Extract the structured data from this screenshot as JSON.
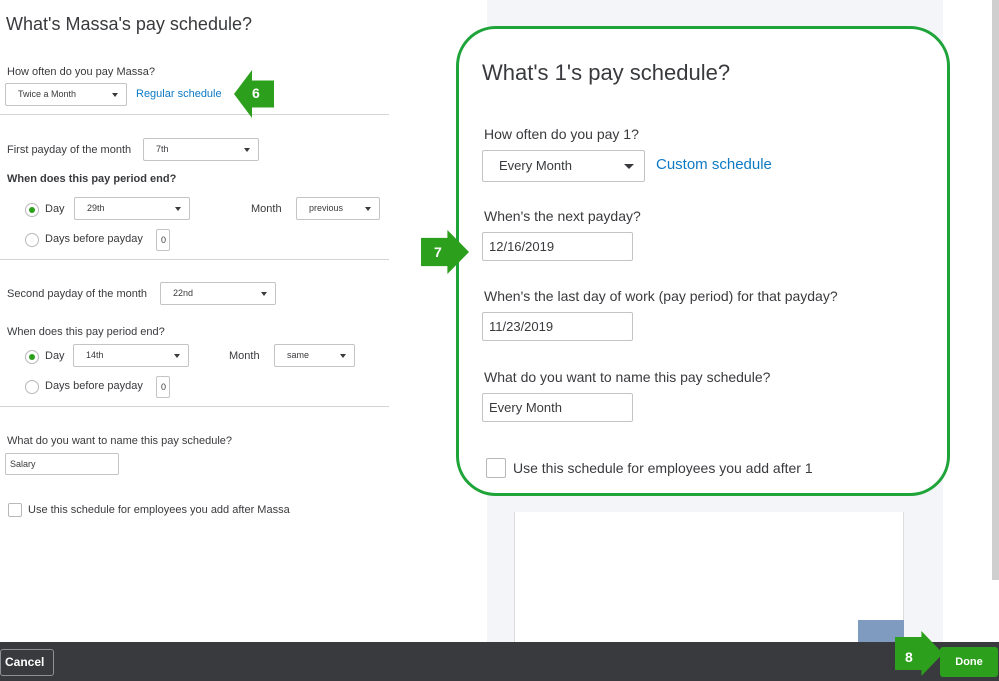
{
  "left": {
    "title": "What's Massa's pay schedule?",
    "frequency_label": "How often do you pay Massa?",
    "frequency_value": "Twice a Month",
    "frequency_link": "Regular schedule",
    "first_payday_label": "First payday of the month",
    "first_payday_value": "7th",
    "first_period_end_label": "When does this pay period end?",
    "first_day_option": "Day",
    "first_day_value": "29th",
    "first_month_label": "Month",
    "first_month_value": "previous",
    "first_days_before_label": "Days before payday",
    "first_days_before_value": "0",
    "second_payday_label": "Second payday of the month",
    "second_payday_value": "22nd",
    "second_period_end_label": "When does this pay period end?",
    "second_day_option": "Day",
    "second_day_value": "14th",
    "second_month_label": "Month",
    "second_month_value": "same",
    "second_days_before_label": "Days before payday",
    "second_days_before_value": "0",
    "name_label": "What do you want to name this pay schedule?",
    "name_value": "Salary",
    "use_schedule_label": "Use this schedule for employees you add after Massa"
  },
  "callout": {
    "title": "What's 1's pay schedule?",
    "frequency_label": "How often do you pay 1?",
    "frequency_value": "Every Month",
    "frequency_link": "Custom schedule",
    "next_payday_label": "When's the next payday?",
    "next_payday_value": "12/16/2019",
    "last_day_label": "When's the last day of work (pay period) for that payday?",
    "last_day_value": "11/23/2019",
    "name_label": "What do you want to name this pay schedule?",
    "name_value": "Every Month",
    "use_schedule_label": "Use this schedule for employees you add after 1"
  },
  "steps": {
    "step6": "6",
    "step7": "7",
    "step8": "8"
  },
  "footer": {
    "cancel_label": "Cancel",
    "done_label": "Done"
  },
  "colors": {
    "accent_green": "#2ca01c",
    "callout_border": "#1fa43a",
    "link_blue": "#0d7ac4",
    "footer_bg": "#393a3d"
  }
}
